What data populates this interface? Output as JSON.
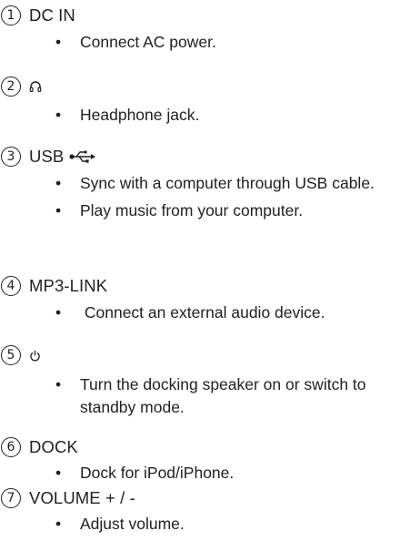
{
  "items": [
    {
      "number": "1",
      "title": "DC IN",
      "icon": "",
      "bullets": [
        {
          "dot": "•",
          "text": "Connect AC power."
        }
      ]
    },
    {
      "number": "2",
      "title": "",
      "icon": "headphone-icon",
      "bullets": [
        {
          "dot": "•",
          "text": "Headphone jack."
        }
      ]
    },
    {
      "number": "3",
      "title": "USB",
      "icon": "usb-icon",
      "bullets": [
        {
          "dot": "•",
          "text": "Sync with a computer through USB cable."
        },
        {
          "dot": "•",
          "text": "Play music from your computer."
        }
      ]
    },
    {
      "number": "4",
      "title": "MP3-LINK",
      "icon": "",
      "bullets": [
        {
          "dot": "•",
          "text": " Connect an external audio device."
        }
      ]
    },
    {
      "number": "5",
      "title": "",
      "icon": "power-icon",
      "bullets": [
        {
          "dot": "•",
          "text": "Turn the docking speaker on or switch to standby mode."
        }
      ]
    },
    {
      "number": "6",
      "title": "DOCK",
      "icon": "",
      "bullets": [
        {
          "dot": "•",
          "text": "Dock for iPod/iPhone."
        }
      ]
    },
    {
      "number": "7",
      "title": "VOLUME + / -",
      "icon": "",
      "bullets": [
        {
          "dot": "•",
          "text": "Adjust volume."
        }
      ]
    }
  ]
}
